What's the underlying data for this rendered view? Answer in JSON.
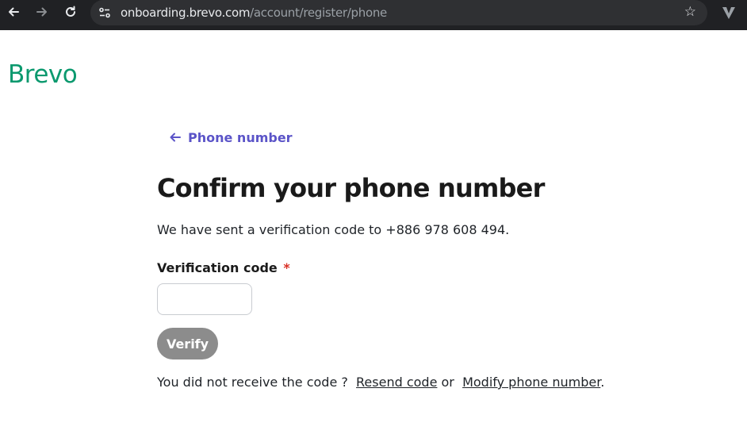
{
  "browser": {
    "url_host": "onboarding.brevo.com",
    "url_path": "/account/register/phone"
  },
  "logo": {
    "text": "Brevo",
    "color": "#0b996e"
  },
  "back_link": {
    "label": "Phone number"
  },
  "page_title": "Confirm your phone number",
  "sent_message": "We have sent a verification code to +886 978 608 494.",
  "verification_field": {
    "label": "Verification code",
    "required_mark": "*",
    "value": "",
    "placeholder": ""
  },
  "verify_button": {
    "label": "Verify"
  },
  "resend": {
    "prompt": "You did not receive the code ?",
    "resend_label": "Resend code",
    "or_text": "or",
    "modify_label": "Modify phone number",
    "period": "."
  },
  "colors": {
    "accent": "#5b54c8",
    "button_disabled": "#8c8c8c",
    "required": "#d93025"
  }
}
